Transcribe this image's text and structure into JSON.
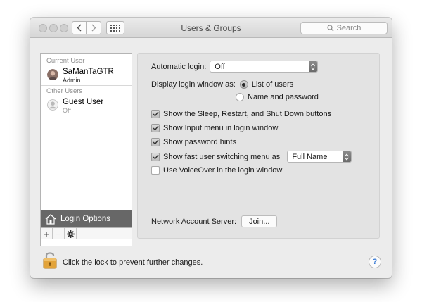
{
  "window": {
    "title": "Users & Groups",
    "search_placeholder": "Search"
  },
  "sidebar": {
    "current_user_label": "Current User",
    "current_user": {
      "name": "SaManTaGTR",
      "role": "Admin"
    },
    "other_users_label": "Other Users",
    "other_users": [
      {
        "name": "Guest User",
        "status": "Off"
      }
    ],
    "login_options_label": "Login Options",
    "tools": {
      "add": "+",
      "remove": "−"
    }
  },
  "login_options": {
    "automatic_login_label": "Automatic login:",
    "automatic_login_value": "Off",
    "display_window_label": "Display login window as:",
    "display_window_options": [
      {
        "label": "List of users",
        "selected": true
      },
      {
        "label": "Name and password",
        "selected": false
      }
    ],
    "checkboxes": [
      {
        "label": "Show the Sleep, Restart, and Shut Down buttons",
        "checked": true
      },
      {
        "label": "Show Input menu in login window",
        "checked": true
      },
      {
        "label": "Show password hints",
        "checked": true
      },
      {
        "label": "Show fast user switching menu as",
        "checked": true
      },
      {
        "label": "Use VoiceOver in the login window",
        "checked": false
      }
    ],
    "fast_switch_value": "Full Name",
    "network_server_label": "Network Account Server:",
    "join_button": "Join..."
  },
  "footer": {
    "lock_text": "Click the lock to prevent further changes.",
    "help_label": "?"
  }
}
